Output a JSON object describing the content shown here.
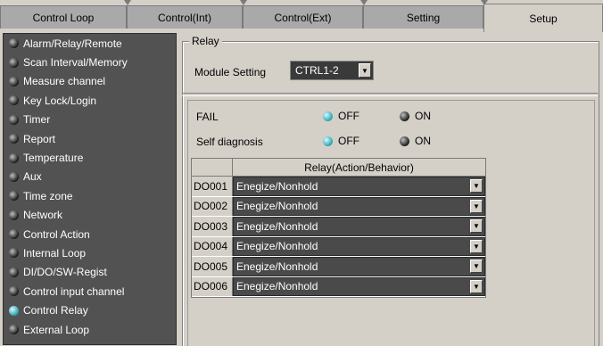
{
  "tabs": [
    {
      "label": "Control Loop"
    },
    {
      "label": "Control(Int)"
    },
    {
      "label": "Control(Ext)"
    },
    {
      "label": "Setting"
    },
    {
      "label": "Setup"
    }
  ],
  "active_tab": "Setup",
  "sidebar": {
    "items": [
      {
        "label": "Alarm/Relay/Remote",
        "state": "off"
      },
      {
        "label": "Scan Interval/Memory",
        "state": "off"
      },
      {
        "label": "Measure channel",
        "state": "off"
      },
      {
        "label": "Key Lock/Login",
        "state": "off"
      },
      {
        "label": "Timer",
        "state": "off"
      },
      {
        "label": "Report",
        "state": "off"
      },
      {
        "label": "Temperature",
        "state": "off"
      },
      {
        "label": "Aux",
        "state": "off"
      },
      {
        "label": "Time zone",
        "state": "off"
      },
      {
        "label": "Network",
        "state": "off"
      },
      {
        "label": "Control Action",
        "state": "off"
      },
      {
        "label": "Internal Loop",
        "state": "off"
      },
      {
        "label": "DI/DO/SW-Regist",
        "state": "off"
      },
      {
        "label": "Control input channel",
        "state": "off"
      },
      {
        "label": "Control Relay",
        "state": "on"
      },
      {
        "label": "External Loop",
        "state": "off"
      }
    ]
  },
  "relay": {
    "group_title": "Relay",
    "module_label": "Module Setting",
    "module_value": "CTRL1-2",
    "fail": {
      "label": "FAIL",
      "off": "OFF",
      "on": "ON",
      "selected": "OFF"
    },
    "self_diag": {
      "label": "Self diagnosis",
      "off": "OFF",
      "on": "ON",
      "selected": "OFF"
    },
    "table": {
      "header": "Relay(Action/Behavior)",
      "rows": [
        {
          "id": "DO001",
          "value": "Enegize/Nonhold"
        },
        {
          "id": "DO002",
          "value": "Enegize/Nonhold"
        },
        {
          "id": "DO003",
          "value": "Enegize/Nonhold"
        },
        {
          "id": "DO004",
          "value": "Enegize/Nonhold"
        },
        {
          "id": "DO005",
          "value": "Enegize/Nonhold"
        },
        {
          "id": "DO006",
          "value": "Enegize/Nonhold"
        }
      ]
    }
  },
  "icons": {
    "dropdown": "chevron-down-icon",
    "indicator": "radio-led-icon"
  },
  "colors": {
    "led_on": "#2aa2b0",
    "sidebar_bg": "#525252",
    "panel_bg": "#d4d0c8",
    "cell_bg": "#4a4a4a"
  }
}
